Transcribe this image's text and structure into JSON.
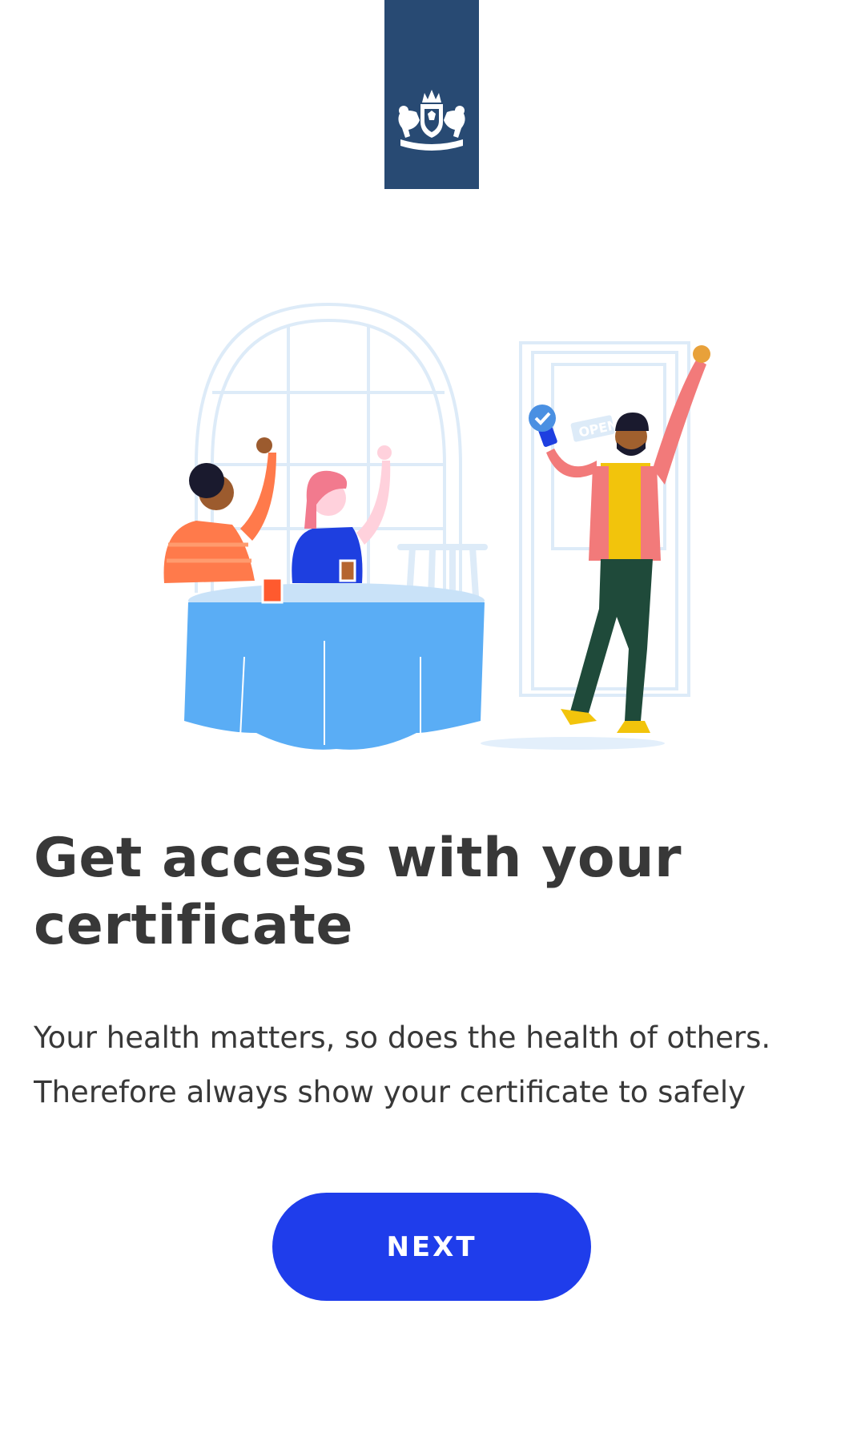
{
  "header": {
    "logo_icon": "dutch-government-coat-of-arms",
    "banner_color": "#284A73"
  },
  "illustration": {
    "icon": "restaurant-access-illustration",
    "sign_text": "OPEN"
  },
  "content": {
    "title": "Get access with your certificate",
    "body": "Your health matters, so does the health of others. Therefore always show your certificate to safely"
  },
  "actions": {
    "next_label": "NEXT",
    "button_color": "#1F3DEB"
  }
}
